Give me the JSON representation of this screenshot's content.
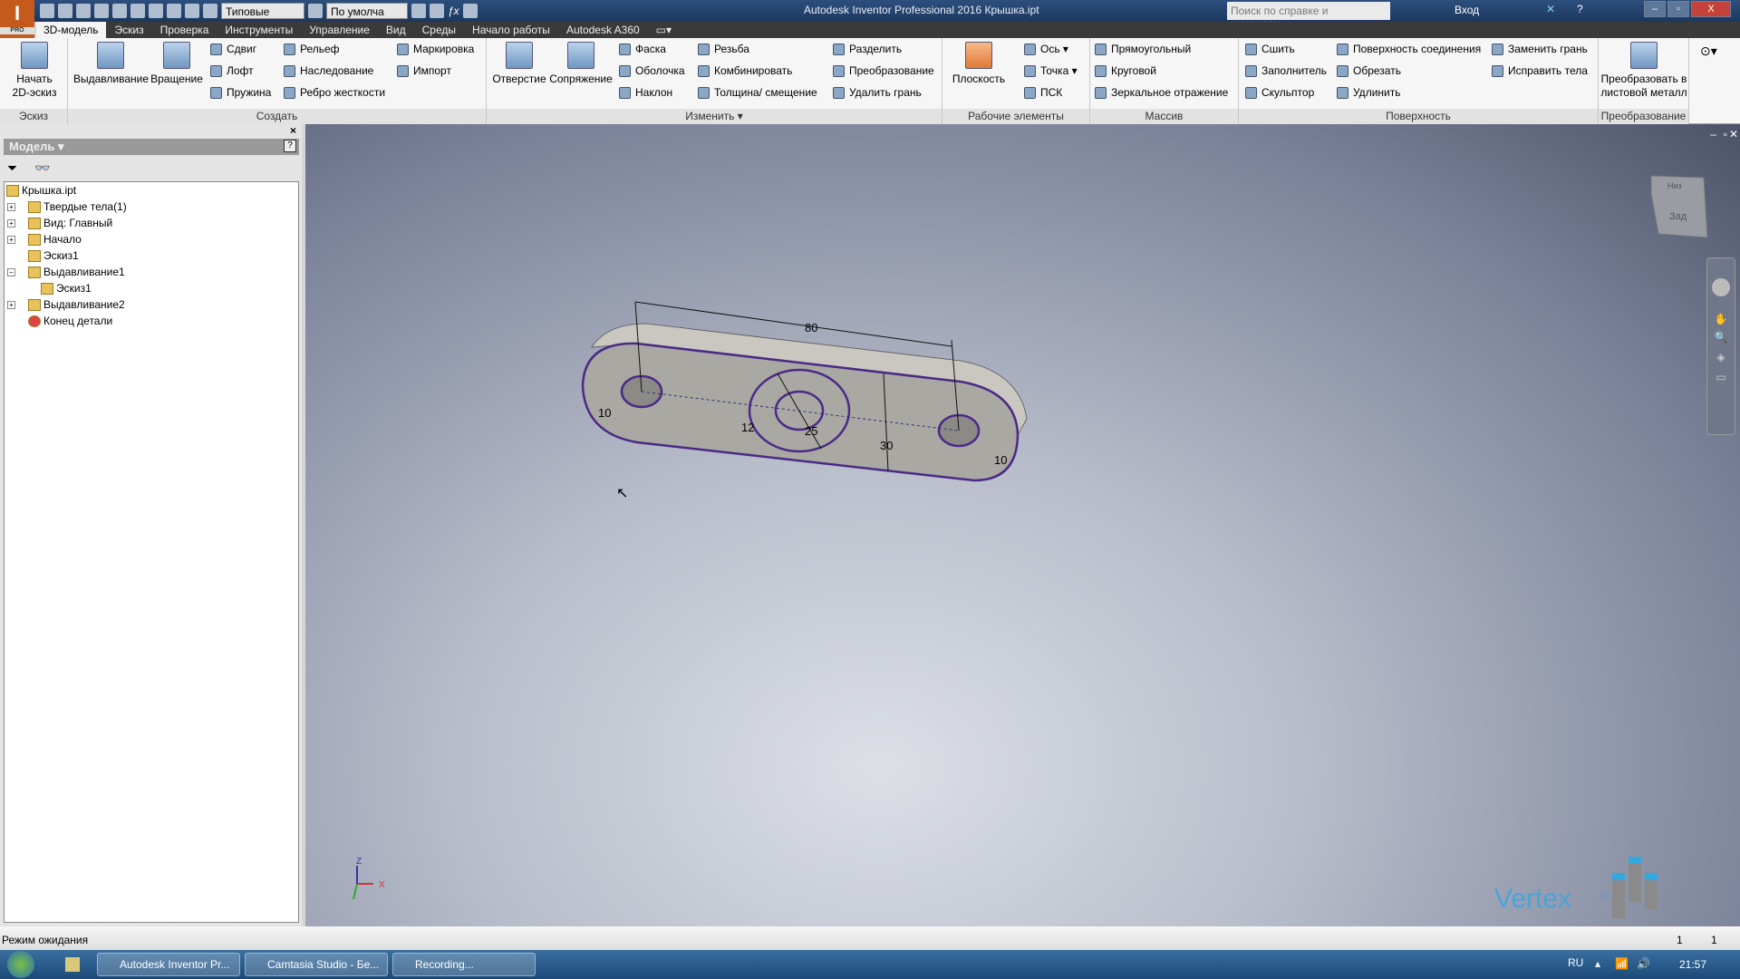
{
  "app": {
    "title": "Autodesk Inventor Professional 2016    Крышка.ipt",
    "logo_badge": "PRO"
  },
  "qat": {
    "style_combo": "Типовые",
    "material_combo": "По умолча"
  },
  "search": {
    "placeholder": "Поиск по справке и командам..."
  },
  "login": "Вход",
  "tabs": [
    "3D-модель",
    "Эскиз",
    "Проверка",
    "Инструменты",
    "Управление",
    "Вид",
    "Среды",
    "Начало работы",
    "Autodesk A360"
  ],
  "active_tab": "3D-модель",
  "ribbon": {
    "sketch": {
      "label": "Эскиз",
      "start": "Начать 2D-эскиз"
    },
    "create": {
      "label": "Создать",
      "big": [
        "Выдавливание",
        "Вращение"
      ],
      "col1": [
        "Сдвиг",
        "Лофт",
        "Пружина"
      ],
      "col2": [
        "Рельеф",
        "Наследование",
        "Ребро жесткости"
      ],
      "col3": [
        "Маркировка",
        "Импорт"
      ]
    },
    "modify": {
      "label": "Изменить ▾",
      "big": [
        "Отверстие",
        "Сопряжение"
      ],
      "col1": [
        "Фаска",
        "Оболочка",
        "Наклон"
      ],
      "col2": [
        "Резьба",
        "Комбинировать",
        "Толщина/ смещение"
      ],
      "col3": [
        "Разделить",
        "Преобразование",
        "Удалить грань"
      ]
    },
    "work": {
      "label": "Рабочие элементы",
      "big": "Плоскость",
      "col": [
        "Ось ▾",
        "Точка ▾",
        "ПСК"
      ]
    },
    "pattern": {
      "label": "Массив",
      "col": [
        "Прямоугольный",
        "Круговой",
        "Зеркальное отражение"
      ]
    },
    "surface": {
      "label": "Поверхность",
      "col1": [
        "Сшить",
        "Заполнитель",
        "Скульптор"
      ],
      "col2": [
        "Поверхность соединения",
        "Обрезать",
        "Удлинить"
      ],
      "col3": [
        "Заменить грань",
        "Исправить тела"
      ]
    },
    "convert": {
      "label": "Преобразование",
      "big": "Преобразовать в листовой металл"
    }
  },
  "panel": {
    "title": "Модель ▾",
    "help": "?",
    "tree": [
      {
        "label": "Крышка.ipt",
        "level": 0,
        "icon": "part-icon"
      },
      {
        "label": "Твердые тела(1)",
        "level": 1,
        "expander": "+",
        "icon": "solid-bodies-icon"
      },
      {
        "label": "Вид: Главный",
        "level": 1,
        "expander": "+",
        "icon": "view-icon"
      },
      {
        "label": "Начало",
        "level": 1,
        "expander": "+",
        "icon": "folder-icon"
      },
      {
        "label": "Эскиз1",
        "level": 1,
        "icon": "sketch-icon"
      },
      {
        "label": "Выдавливание1",
        "level": 1,
        "expander": "−",
        "icon": "extrude-icon"
      },
      {
        "label": "Эскиз1",
        "level": 2,
        "icon": "sketch-icon"
      },
      {
        "label": "Выдавливание2",
        "level": 1,
        "expander": "+",
        "icon": "extrude-icon"
      },
      {
        "label": "Конец детали",
        "level": 1,
        "icon": "end-of-part-icon"
      }
    ]
  },
  "model": {
    "dimensions": [
      "80",
      "10",
      "12",
      "25",
      "30",
      "10"
    ],
    "viewcube": {
      "top": "Низ",
      "front": "Зад"
    },
    "axes": [
      "Z",
      "X"
    ],
    "outline_color": "#4b2a86"
  },
  "watermark": "Vertex",
  "status": {
    "text": "Режим ожидания",
    "count1": "1",
    "count2": "1"
  },
  "taskbar": {
    "items": [
      "Autodesk Inventor Pr...",
      "Camtasia Studio - Бе...",
      "Recording..."
    ],
    "lang": "RU",
    "clock": "21:57"
  }
}
